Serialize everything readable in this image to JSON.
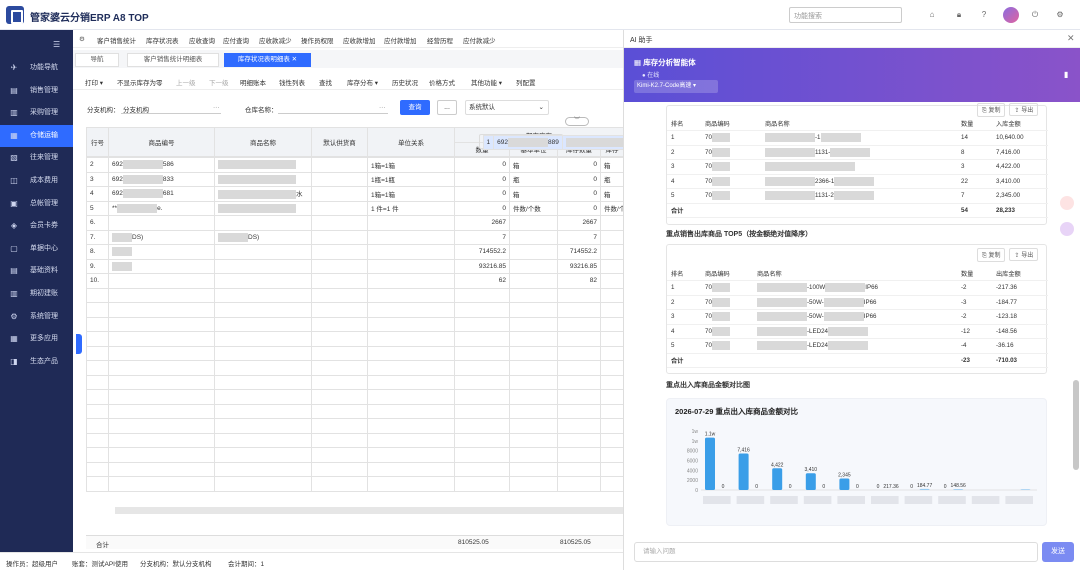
{
  "app": {
    "title": "管家婆云分销ERP A8 TOP",
    "search_placeholder": "功能搜索"
  },
  "sidebar": {
    "items": [
      {
        "label": "功能导航",
        "icon": "navigate-icon"
      },
      {
        "label": "销售管理",
        "icon": "sales-icon"
      },
      {
        "label": "采购管理",
        "icon": "purchase-icon"
      },
      {
        "label": "仓储运输",
        "icon": "warehouse-icon",
        "active": true
      },
      {
        "label": "往来管理",
        "icon": "contacts-icon"
      },
      {
        "label": "成本费用",
        "icon": "cost-icon"
      },
      {
        "label": "总帐管理",
        "icon": "ledger-icon"
      },
      {
        "label": "会员卡券",
        "icon": "member-icon"
      },
      {
        "label": "单据中心",
        "icon": "document-icon"
      },
      {
        "label": "基础资料",
        "icon": "basic-data-icon"
      },
      {
        "label": "期初建账",
        "icon": "opening-icon"
      },
      {
        "label": "系统管理",
        "icon": "system-icon"
      },
      {
        "label": "更多应用",
        "icon": "apps-icon"
      },
      {
        "label": "生态产品",
        "icon": "eco-icon"
      }
    ]
  },
  "menubar": [
    "客户销售统计",
    "库存状况表",
    "应收查询",
    "应付查询",
    "应收款减少",
    "操作员权限",
    "应收款增加",
    "应付款增加",
    "经营历程",
    "应付款减少"
  ],
  "tabs": [
    {
      "label": "导航"
    },
    {
      "label": "客户销售统计明细表"
    },
    {
      "label": "库存状况表明细表",
      "active": true
    }
  ],
  "toolbar": [
    {
      "label": "打印 ▾"
    },
    {
      "label": "不显示库存为零"
    },
    {
      "label": "上一级",
      "disabled": true
    },
    {
      "label": "下一级",
      "disabled": true
    },
    {
      "label": "明细账本"
    },
    {
      "label": "钱性列表"
    },
    {
      "label": "查找"
    },
    {
      "label": "库存分布 ▾"
    },
    {
      "label": "历史状况"
    },
    {
      "label": "价格方式"
    },
    {
      "label": "其他功能 ▾"
    },
    {
      "label": "列配置"
    }
  ],
  "filter": {
    "branch_label": "分支机构：",
    "branch_value": "分支机构",
    "warehouse_label": "仓库名称：",
    "query": "查询",
    "more": "...",
    "default": "系统默认"
  },
  "grid": {
    "headers": [
      "行号",
      "商品编号",
      "商品名称",
      "默认供货商",
      "单位关系",
      "数量",
      "基本单位",
      "库存数量",
      "库存"
    ],
    "group_header": "期末库存",
    "rows": [
      {
        "no": "1",
        "code": "692",
        "code2": "889",
        "name_tail": "水",
        "unit": "1箱=1箱",
        "qty": "0",
        "base": "箱",
        "stock": "0",
        "last": "箱"
      },
      {
        "no": "2",
        "code": "692",
        "code2": "586",
        "name_tail": "",
        "unit": "1箱=1箱",
        "qty": "0",
        "base": "箱",
        "stock": "0",
        "last": "箱"
      },
      {
        "no": "3",
        "code": "692",
        "code2": "833",
        "name_tail": "",
        "unit": "1瓶=1瓶",
        "qty": "0",
        "base": "瓶",
        "stock": "0",
        "last": "瓶"
      },
      {
        "no": "4",
        "code": "692",
        "code2": "681",
        "name_tail": "水",
        "unit": "1箱=1箱",
        "qty": "0",
        "base": "箱",
        "stock": "0",
        "last": "箱"
      },
      {
        "no": "5",
        "code": "**",
        "code2": "e.",
        "name_tail": "",
        "unit": "1 件=1 件",
        "qty": "0",
        "base": "件数/个数",
        "stock": "0",
        "last": "件数/个"
      },
      {
        "no": "6.",
        "code": "",
        "code2": "",
        "name_tail": "",
        "unit": "",
        "qty": "2667",
        "base": "",
        "stock": "2667",
        "last": ""
      },
      {
        "no": "7.",
        "code": "",
        "code2": "DS)",
        "name_tail": "DS)",
        "unit": "",
        "qty": "7",
        "base": "",
        "stock": "7",
        "last": ""
      },
      {
        "no": "8.",
        "code": "",
        "code2": "",
        "name_tail": "",
        "unit": "",
        "qty": "714552.2",
        "base": "",
        "stock": "714552.2",
        "last": ""
      },
      {
        "no": "9.",
        "code": "",
        "code2": "",
        "name_tail": "",
        "unit": "",
        "qty": "93216.85",
        "base": "",
        "stock": "93216.85",
        "last": ""
      },
      {
        "no": "10.",
        "code": "",
        "code2": "",
        "name_tail": "",
        "unit": "",
        "qty": "62",
        "base": "",
        "stock": "82",
        "last": ""
      }
    ],
    "sum_label": "合计",
    "sum_qty": "810525.05",
    "sum_stock": "810525.05"
  },
  "statusbar": {
    "operator": "操作员：超级用户",
    "account": "账套：测试API使用",
    "branch": "分支机构：默认分支机构",
    "period": "会计期间：1"
  },
  "ai": {
    "title": "AI 助手",
    "agent_name": "库存分析智能体",
    "status": "在线",
    "model": "Kimi-K2.7-Code高速",
    "copy": "复制",
    "export": "导出",
    "table1": {
      "headers": [
        "排名",
        "商品编码",
        "商品名称",
        "数量",
        "入库金额"
      ],
      "rows": [
        {
          "rank": "1",
          "code": "70",
          "name": "-1",
          "qty": "14",
          "amt": "10,640.00"
        },
        {
          "rank": "2",
          "code": "70",
          "name": "1131-",
          "qty": "8",
          "amt": "7,416.00"
        },
        {
          "rank": "3",
          "code": "70",
          "name": "",
          "qty": "3",
          "amt": "4,422.00"
        },
        {
          "rank": "4",
          "code": "70",
          "name": "2366-1",
          "qty": "22",
          "amt": "3,410.00"
        },
        {
          "rank": "5",
          "code": "70",
          "name": "1131-2",
          "qty": "7",
          "amt": "2,345.00"
        }
      ],
      "total_label": "合计",
      "total_qty": "54",
      "total_amt": "28,233"
    },
    "section2": "重点销售出库商品 TOP5（按金额绝对值降序）",
    "table2": {
      "headers": [
        "排名",
        "商品编码",
        "商品名称",
        "数量",
        "出库金额"
      ],
      "rows": [
        {
          "rank": "1",
          "code": "70",
          "name": "-100W",
          "tail": "IP66",
          "qty": "-2",
          "amt": "-217.36"
        },
        {
          "rank": "2",
          "code": "70",
          "name": "-50W-",
          "tail": "IP66",
          "qty": "-3",
          "amt": "-184.77"
        },
        {
          "rank": "3",
          "code": "70",
          "name": "-50W-",
          "tail": "IP66",
          "qty": "-2",
          "amt": "-123.18"
        },
        {
          "rank": "4",
          "code": "70",
          "name": "-LED24",
          "tail": "",
          "qty": "-12",
          "amt": "-148.56"
        },
        {
          "rank": "5",
          "code": "70",
          "name": "-LED24",
          "tail": "",
          "qty": "-4",
          "amt": "-36.16"
        }
      ],
      "total_label": "合计",
      "total_qty": "-23",
      "total_amt": "-710.03"
    },
    "section3": "重点出入库商品金额对比图",
    "input_placeholder": "请输入问题",
    "send": "发送"
  },
  "chart_data": {
    "type": "bar",
    "title": "2026-07-29 重点出入库商品金额对比",
    "y_ticks": [
      "1w",
      "1w",
      "8000",
      "6000",
      "4000",
      "2000",
      "0"
    ],
    "categories": [
      "1",
      "2",
      "3",
      "4",
      "5",
      "6",
      "7",
      "8",
      "9",
      "10"
    ],
    "series": [
      {
        "values": [
          10640,
          7416,
          4422,
          3410,
          2345,
          0,
          0,
          0,
          0,
          0
        ]
      },
      {
        "values": [
          0,
          0,
          0,
          0,
          0,
          0,
          217.36,
          184.77,
          0,
          148.56
        ]
      }
    ],
    "data_labels": [
      "1.1w",
      "0",
      "7,416",
      "0",
      "4,422",
      "0",
      "3,410",
      "0",
      "2,345",
      "0",
      "0",
      "217.36",
      "0",
      "184.77",
      "0",
      "148.56"
    ]
  }
}
